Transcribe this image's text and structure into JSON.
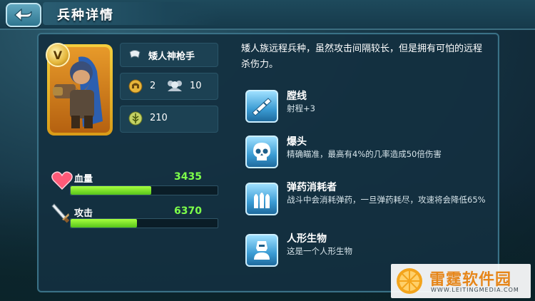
{
  "header": {
    "title": "兵种详情",
    "back_icon": "back-arrow-icon"
  },
  "unit": {
    "rank": "V",
    "name": "矮人神枪手",
    "population": "2",
    "capacity": "10",
    "cost": "210"
  },
  "stats": {
    "hp_label": "血量",
    "hp_value": "3435",
    "hp_fill": 0.55,
    "atk_label": "攻击",
    "atk_value": "6370",
    "atk_fill": 0.45
  },
  "description": "矮人族远程兵种，虽然攻击间隔较长，但是拥有可怕的远程杀伤力。",
  "skills": [
    {
      "name": "膛线",
      "desc": "射程+3",
      "icon": "rifle-icon"
    },
    {
      "name": "爆头",
      "desc": "精确瞄准，最高有4%的几率造成50倍伤害",
      "icon": "skull-icon"
    },
    {
      "name": "弹药消耗者",
      "desc": "战斗中会消耗弹药，一旦弹药耗尽，攻速将会降低65%",
      "icon": "ammo-icon"
    },
    {
      "name": "人形生物",
      "desc": "这是一个人形生物",
      "icon": "humanoid-icon"
    }
  ],
  "watermark": {
    "text": "雷霆软件园",
    "url": "WWW.LEITINGMEDIA.COM"
  },
  "colors": {
    "bar_green": "#7dff4a",
    "panel_bg": "#14303f",
    "accent_blue": "#3b9cd4",
    "gold": "#e5b63a"
  }
}
